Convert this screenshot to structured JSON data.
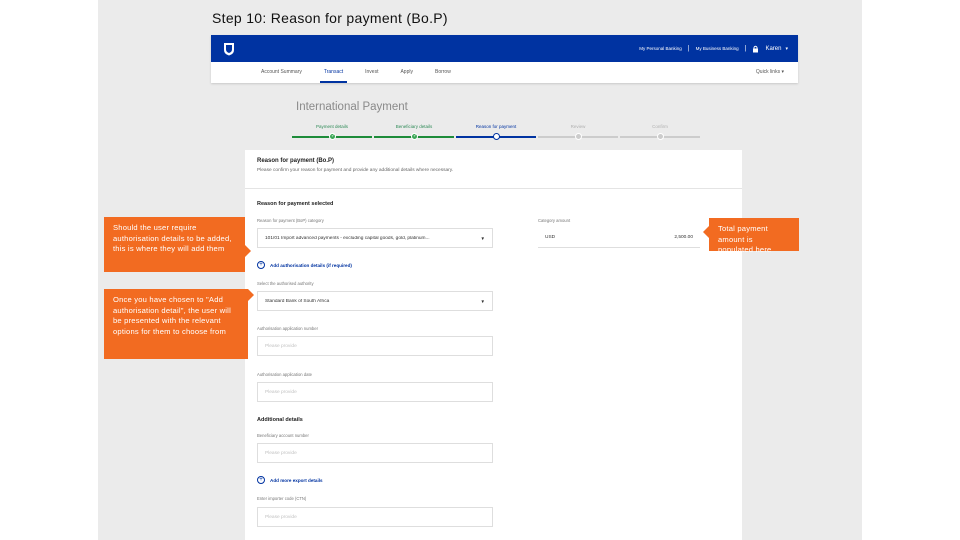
{
  "slide": {
    "title": "Step 10: Reason for payment (Bo.P)"
  },
  "topbar": {
    "personal_banking": "My Personal Banking",
    "separator": "|",
    "business_banking": "My Business Banking",
    "user_name": "Karen",
    "brand_color": "#0033a1"
  },
  "subnav": {
    "items": [
      "Account Summary",
      "Transact",
      "Invest",
      "Apply",
      "Borrow"
    ],
    "active": "Transact",
    "quick_links": "Quick links"
  },
  "page": {
    "heading": "International Payment"
  },
  "stepper": {
    "steps": [
      {
        "label": "Payment details",
        "state": "done"
      },
      {
        "label": "Beneficiary details",
        "state": "done"
      },
      {
        "label": "Reason for payment",
        "state": "current"
      },
      {
        "label": "Review",
        "state": "todo"
      },
      {
        "label": "Confirm",
        "state": "todo"
      }
    ]
  },
  "form": {
    "title": "Reason for payment (Bo.P)",
    "subtitle": "Please confirm your reason for payment and provide any additional details where necessary.",
    "section_selected": "Reason for payment selected",
    "category_label": "Reason for payment (BoP) category",
    "category_value": "101/01 Import advanced payments - excluding capital goods, gold, platinum...",
    "amount_label": "Category amount",
    "amount_currency": "USD",
    "amount_value": "2,500.00",
    "add_auth_link": "Add authorisation details (if required)",
    "authoriser_label": "Select the authorised authority",
    "authoriser_value": "Standard Bank of South Africa",
    "auth_number_label": "Authorisation application number",
    "auth_number_placeholder": "Please provide",
    "auth_date_label": "Authorisation application date",
    "auth_date_placeholder": "Please provide",
    "additional_title": "Additional details",
    "beneficiary_label": "Beneficiary account number",
    "beneficiary_placeholder": "Please provide",
    "add_export_link": "Add more export details",
    "importer_label": "Enter importer code (CTN)",
    "importer_placeholder": "Please provide"
  },
  "callouts": {
    "auth_details": "Should the user require authorisation details to be added, this is where they will add them",
    "auth_options": "Once you have chosen to \"Add authorisation detail\", the user will be presented with the relevant options for them to choose from",
    "total_amount": "Total payment amount is populated here",
    "color": "#f26b21"
  }
}
